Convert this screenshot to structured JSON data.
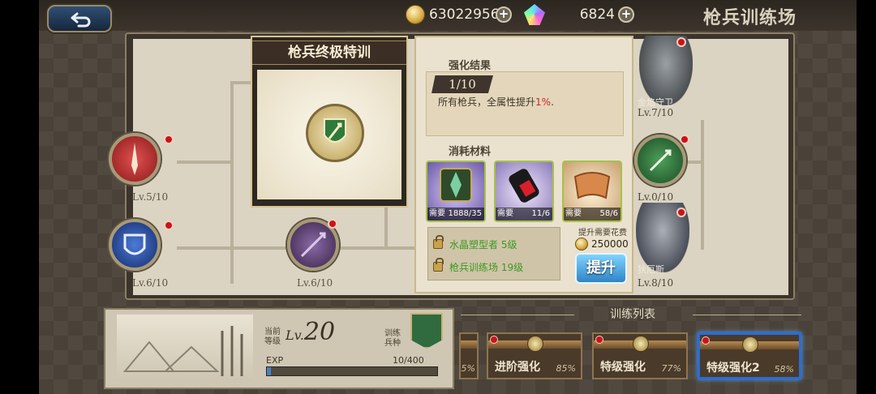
{
  "header": {
    "coins": "63022956",
    "gems": "6824",
    "title": "枪兵训练场"
  },
  "card": {
    "title": "枪兵终极特训"
  },
  "tree_nodes": [
    {
      "level": "Lv.5/10"
    },
    {
      "level": "Lv.6/10"
    },
    {
      "level": "Lv.6/10"
    }
  ],
  "detail": {
    "result_title": "强化结果",
    "level": "1/10",
    "effect_prefix": "所有枪兵，全属性提升",
    "effect_value": "1%",
    "effect_suffix": ".",
    "materials_title": "消耗材料",
    "materials": [
      {
        "need_label": "需要",
        "count": "1888/35"
      },
      {
        "need_label": "需要",
        "count": "11/6"
      },
      {
        "need_label": "需要",
        "count": "58/6"
      }
    ],
    "requirements": [
      "水晶塑型者 5级",
      "枪兵训练场 19级"
    ],
    "cost_label": "提升需要花费",
    "cost_value": "250000",
    "upgrade_label": "提升"
  },
  "characters": [
    {
      "caption": "金焰守卫",
      "level": "Lv.7/10"
    },
    {
      "caption": "",
      "level": "Lv.0/10"
    },
    {
      "caption": "狄厄斯",
      "level": "Lv.8/10"
    }
  ],
  "info": {
    "current_level_label": "当前等级",
    "level_prefix": "Lv.",
    "level": "20",
    "type_label": "训练兵种",
    "exp_label": "EXP",
    "exp_value": "10/400",
    "exp_fraction": 0.025
  },
  "training_list": {
    "title": "训练列表",
    "items": [
      {
        "name": "",
        "pct": "5%"
      },
      {
        "name": "进阶强化",
        "pct": "85%"
      },
      {
        "name": "特级强化",
        "pct": "77%"
      },
      {
        "name": "特级强化2",
        "pct": "58%"
      }
    ]
  }
}
